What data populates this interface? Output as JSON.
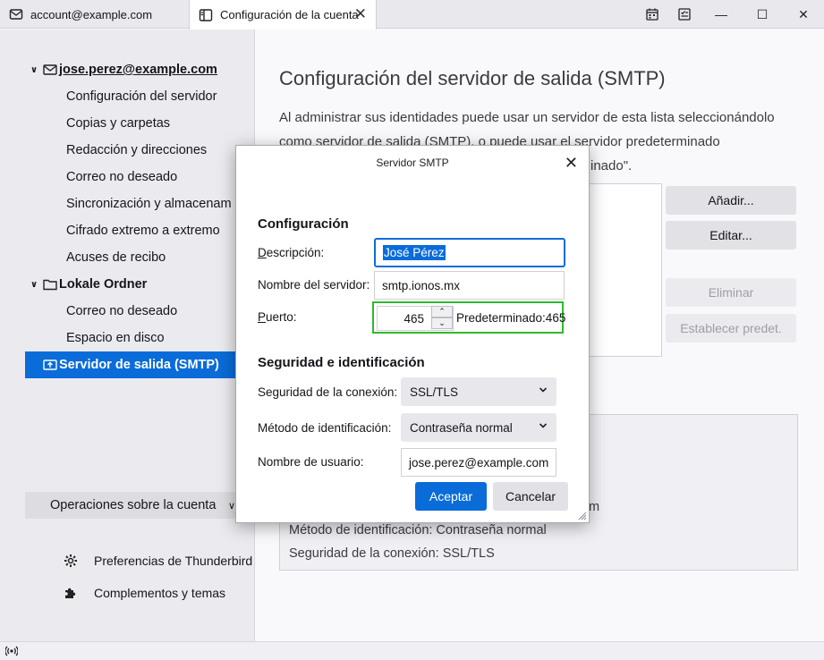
{
  "tabs": [
    {
      "label": "account@example.com",
      "icon": "mail-icon"
    },
    {
      "label": "Configuración de la cuenta",
      "icon": "settings-tab-icon"
    }
  ],
  "window_controls": {
    "minimize": "—",
    "maximize": "☐",
    "close": "✕"
  },
  "tree": {
    "account1": {
      "name": "jose.perez@example.com",
      "children": [
        "Configuración del servidor",
        "Copias y carpetas",
        "Redacción y direcciones",
        "Correo no deseado",
        "Sincronización y almacenam",
        "Cifrado extremo a extremo",
        "Acuses de recibo"
      ]
    },
    "account2": {
      "name": "Lokale Ordner",
      "children": [
        "Correo no deseado",
        "Espacio en disco"
      ]
    },
    "smtp": "Servidor de salida (SMTP)"
  },
  "left_footer": {
    "operations": "Operaciones sobre la cuenta",
    "preferences": "Preferencias de Thunderbird",
    "addons": "Complementos y temas"
  },
  "main": {
    "title": "Configuración del servidor de salida (SMTP)",
    "intro_line1": "Al administrar sus identidades puede usar un servidor de esta lista seleccionándolo",
    "intro_line2": "como servidor de salida (SMTP), o puede usar el servidor predeterminado",
    "intro_line3_tail": "inado\".",
    "buttons": {
      "add": "Añadir...",
      "edit": "Editar...",
      "delete": "Eliminar",
      "set_default": "Establecer predet."
    },
    "details_visible": {
      "tail": "m",
      "auth_method": "Método de identificación:  Contraseña normal",
      "security": "Seguridad de la conexión:  SSL/TLS"
    }
  },
  "dialog": {
    "title": "Servidor SMTP",
    "section_config": "Configuración",
    "description_label": "Descripción:",
    "description_value": "José Pérez",
    "server_label": "Nombre del servidor:",
    "server_value": "smtp.ionos.mx",
    "port_label": "Puerto:",
    "port_value": "465",
    "port_default": "Predeterminado:465",
    "section_security": "Seguridad e identificación",
    "security_label": "Seguridad de la conexión:",
    "security_value": "SSL/TLS",
    "auth_label": "Método de identificación:",
    "auth_value": "Contraseña normal",
    "username_label": "Nombre de usuario:",
    "username_value": "jose.perez@example.com",
    "accept": "Aceptar",
    "cancel": "Cancelar"
  },
  "colors": {
    "accent": "#0a6cd9",
    "highlight_box": "#2dbb2d"
  }
}
